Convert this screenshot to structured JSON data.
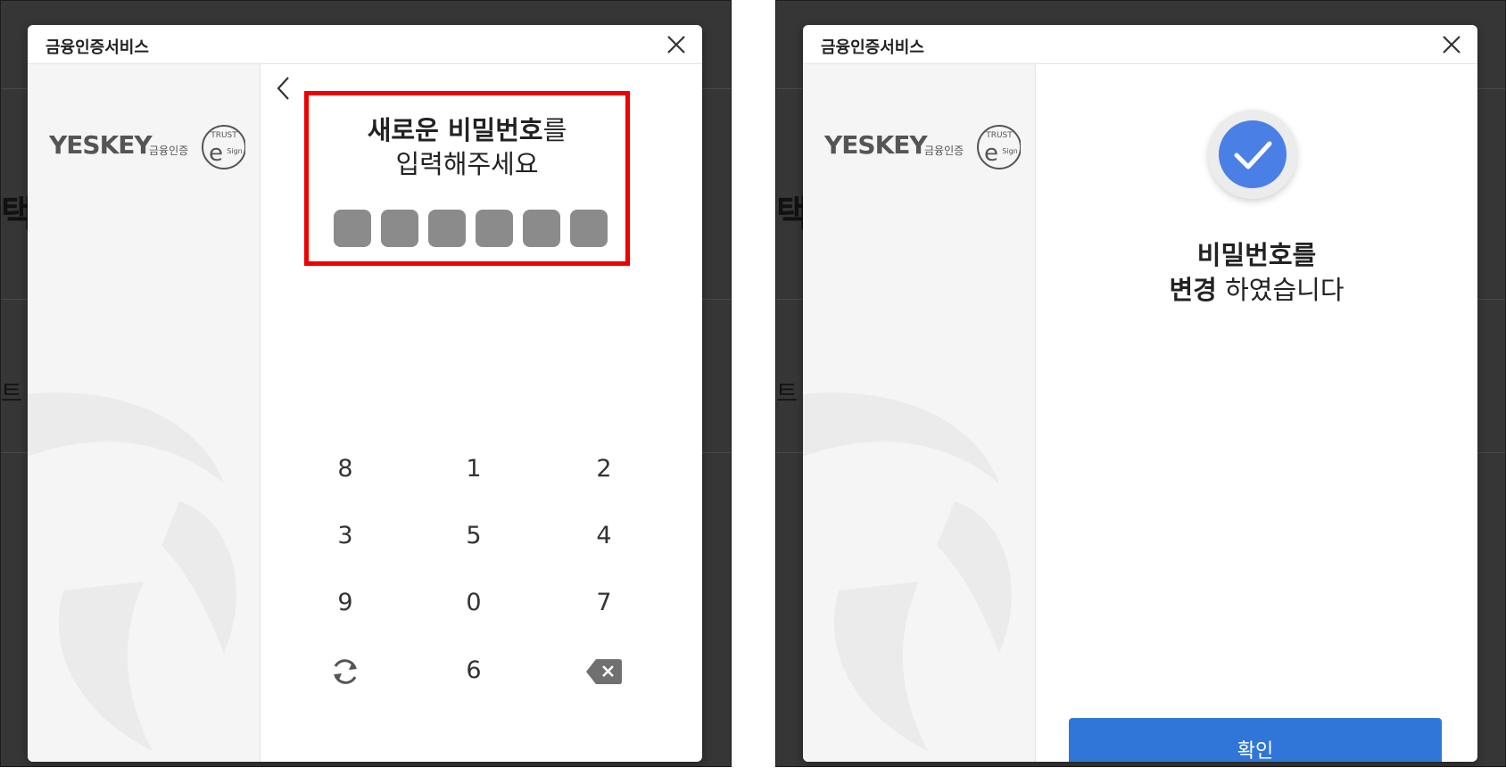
{
  "dialog_title": "금융인증서비스",
  "logo": {
    "brand": "YESKEY",
    "sub": "금융인증",
    "seal_text": "TRUST eSign"
  },
  "background_glyphs": {
    "heading": "택",
    "item": "트"
  },
  "pin_screen": {
    "prompt_bold": "새로운 비밀번호",
    "prompt_rest": "를",
    "prompt_line2": "입력해주세요",
    "pin_length": 6,
    "highlight_color": "#ee0000",
    "keys": [
      "8",
      "1",
      "2",
      "3",
      "5",
      "4",
      "9",
      "0",
      "7",
      "",
      "6",
      ""
    ],
    "special_keys": {
      "refresh": "refresh-icon",
      "delete": "backspace-icon"
    }
  },
  "done_screen": {
    "line1": "비밀번호를",
    "line2_bold": "변경",
    "line2_rest": " 하였습니다",
    "confirm_label": "확인",
    "accent_color": "#2f76d8"
  }
}
